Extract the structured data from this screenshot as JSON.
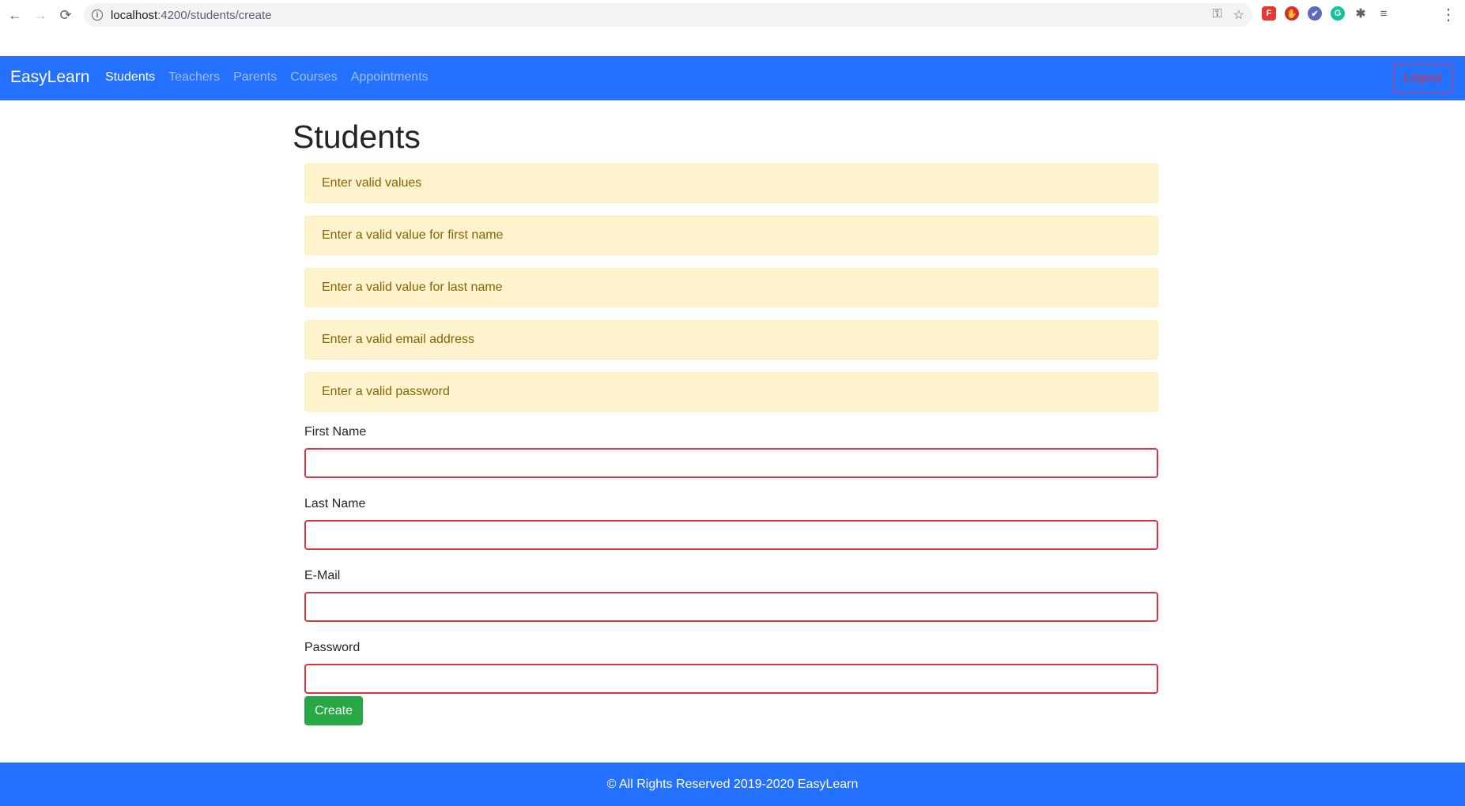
{
  "browser": {
    "url_host": "localhost",
    "url_path": ":4200/students/create",
    "back_icon": "←",
    "forward_icon": "→",
    "reload_icon": "⟳",
    "key_icon": "⚿",
    "star_icon": "☆",
    "menu_icon": "⋮",
    "ext_icons": [
      "F",
      "✋",
      "✔",
      "G",
      "✱",
      "≡"
    ]
  },
  "navbar": {
    "brand": "EasyLearn",
    "links": [
      "Students",
      "Teachers",
      "Parents",
      "Courses",
      "Appointments"
    ],
    "active": "Students",
    "logout_label": "Logout",
    "bg_color": "#2470ff"
  },
  "page": {
    "title": "Students",
    "alerts": [
      "Enter valid values",
      "Enter a valid value for first name",
      "Enter a valid value for last name",
      "Enter a valid email address",
      "Enter a valid password"
    ]
  },
  "form": {
    "fields": [
      {
        "label": "First Name",
        "value": ""
      },
      {
        "label": "Last Name",
        "value": ""
      },
      {
        "label": "E-Mail",
        "value": ""
      },
      {
        "label": "Password",
        "value": ""
      }
    ],
    "submit_label": "Create",
    "error_color": "#dc3545",
    "submit_color": "#28a745"
  },
  "footer": {
    "text": "© All Rights Reserved 2019-2020 EasyLearn"
  }
}
